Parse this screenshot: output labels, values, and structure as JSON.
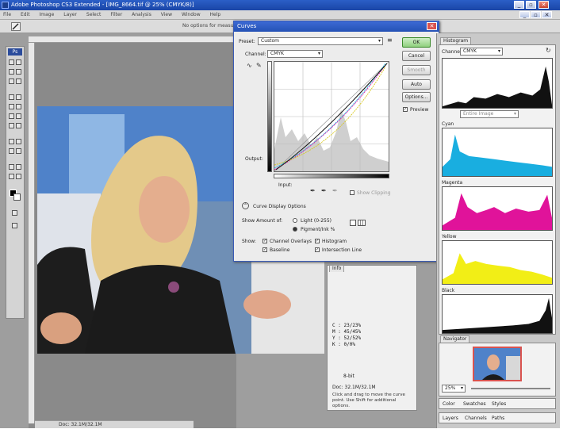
{
  "window": {
    "title": "Adobe Photoshop CS3 Extended - [IMG_8664.tif @ 25% (CMYK/8)]",
    "minimize": "_",
    "restore": "▫",
    "close": "✕",
    "doc_min": "_",
    "doc_restore": "▫",
    "doc_close": "✕"
  },
  "menu": [
    "File",
    "Edit",
    "Image",
    "Layer",
    "Select",
    "Filter",
    "Analysis",
    "View",
    "Window",
    "Help"
  ],
  "optionsbar": {
    "hint": "No options for measure tool"
  },
  "toolbox": {
    "logo": "Ps"
  },
  "status": {
    "doc_size": "Doc: 32.1M/32.1M"
  },
  "curves": {
    "title": "Curves",
    "close": "✕",
    "preset_label": "Preset:",
    "preset_value": "Custom",
    "channel_label": "Channel:",
    "channel_value": "CMYK",
    "input_label": "Input:",
    "output_label": "Output:",
    "buttons": {
      "ok": "OK",
      "cancel": "Cancel",
      "smooth": "Smooth",
      "auto": "Auto",
      "options": "Options..."
    },
    "preview_label": "Preview",
    "show_clipping_label": "Show Clipping",
    "display_options_label": "Curve Display Options",
    "show_amount_label": "Show Amount of:",
    "light_label": "Light (0-255)",
    "pigment_label": "Pigment/Ink %",
    "show_label": "Show:",
    "show_items": [
      "Channel Overlays",
      "Baseline",
      "Histogram",
      "Intersection Line"
    ]
  },
  "info": {
    "tab": "Info",
    "cmyk_rows": [
      [
        "C :",
        "23/",
        "23%"
      ],
      [
        "M :",
        "45/",
        "45%"
      ],
      [
        "Y :",
        "52/",
        "52%"
      ],
      [
        "K :",
        "0/",
        "0%"
      ]
    ],
    "bit_depth": "8-bit",
    "doc_line": "Doc: 32.1M/32.1M",
    "hint": "Click and drag to move the curve point. Use Shift for additional options."
  },
  "histogram": {
    "tab": "Histogram",
    "channel_label": "Channel:",
    "channel_value": "CMYK",
    "source_value": "Entire Image",
    "channels": [
      {
        "name": "Cyan",
        "color": "#19aee0"
      },
      {
        "name": "Magenta",
        "color": "#e0139a"
      },
      {
        "name": "Yellow",
        "color": "#f2ee16"
      },
      {
        "name": "Black",
        "color": "#111111"
      }
    ]
  },
  "navigator": {
    "tab": "Navigator",
    "zoom": "25%"
  },
  "bottom_tabs": [
    [
      "Color",
      "Swatches",
      "Styles"
    ],
    [
      "Layers",
      "Channels",
      "Paths"
    ]
  ],
  "colors": {
    "title_blue": "#1a45a6",
    "workspace": "#9e9e9e"
  }
}
